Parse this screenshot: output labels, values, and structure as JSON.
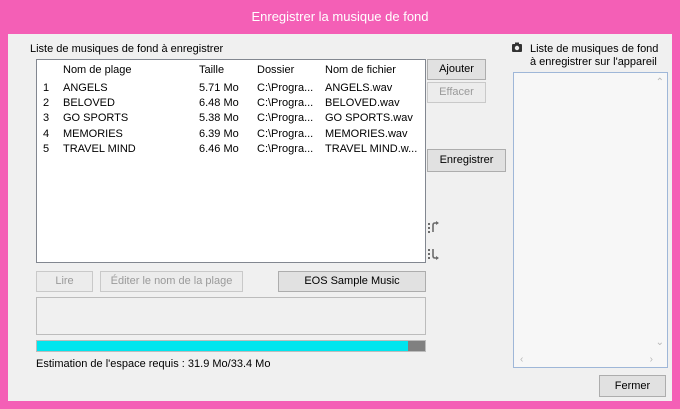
{
  "window": {
    "title": "Enregistrer la musique de fond"
  },
  "left_panel": {
    "list_title": "Liste de musiques de fond à enregistrer",
    "columns": [
      "",
      "Nom de plage",
      "Taille",
      "Dossier",
      "Nom de fichier"
    ],
    "rows": [
      {
        "num": "1",
        "name": "ANGELS",
        "size": "5.71 Mo",
        "folder": "C:\\Progra...",
        "file": "ANGELS.wav"
      },
      {
        "num": "2",
        "name": "BELOVED",
        "size": "6.48 Mo",
        "folder": "C:\\Progra...",
        "file": "BELOVED.wav"
      },
      {
        "num": "3",
        "name": "GO SPORTS",
        "size": "5.38 Mo",
        "folder": "C:\\Progra...",
        "file": "GO SPORTS.wav"
      },
      {
        "num": "4",
        "name": "MEMORIES",
        "size": "6.39 Mo",
        "folder": "C:\\Progra...",
        "file": "MEMORIES.wav"
      },
      {
        "num": "5",
        "name": "TRAVEL MIND",
        "size": "6.46 Mo",
        "folder": "C:\\Progra...",
        "file": "TRAVEL MIND.w..."
      }
    ],
    "buttons": {
      "play": "Lire",
      "edit_name": "Éditer le nom de la plage",
      "sample": "EOS Sample Music"
    },
    "space_estimate": "Estimation de l'espace requis : 31.9 Mo/33.4 Mo",
    "space_fraction": 0.955
  },
  "middle_buttons": {
    "add": "Ajouter",
    "erase": "Effacer",
    "register": "Enregistrer",
    "move_up_icon": "move-up-icon",
    "move_down_icon": "move-down-icon"
  },
  "right_panel": {
    "camera_icon": "camera-icon",
    "title_line1": "Liste de musiques de fond",
    "title_line2": "à enregistrer sur l'appareil"
  },
  "footer": {
    "close": "Fermer"
  },
  "colors": {
    "frame": "#f45fb6",
    "progress": "#00e5ee",
    "progress_over": "#808080"
  }
}
